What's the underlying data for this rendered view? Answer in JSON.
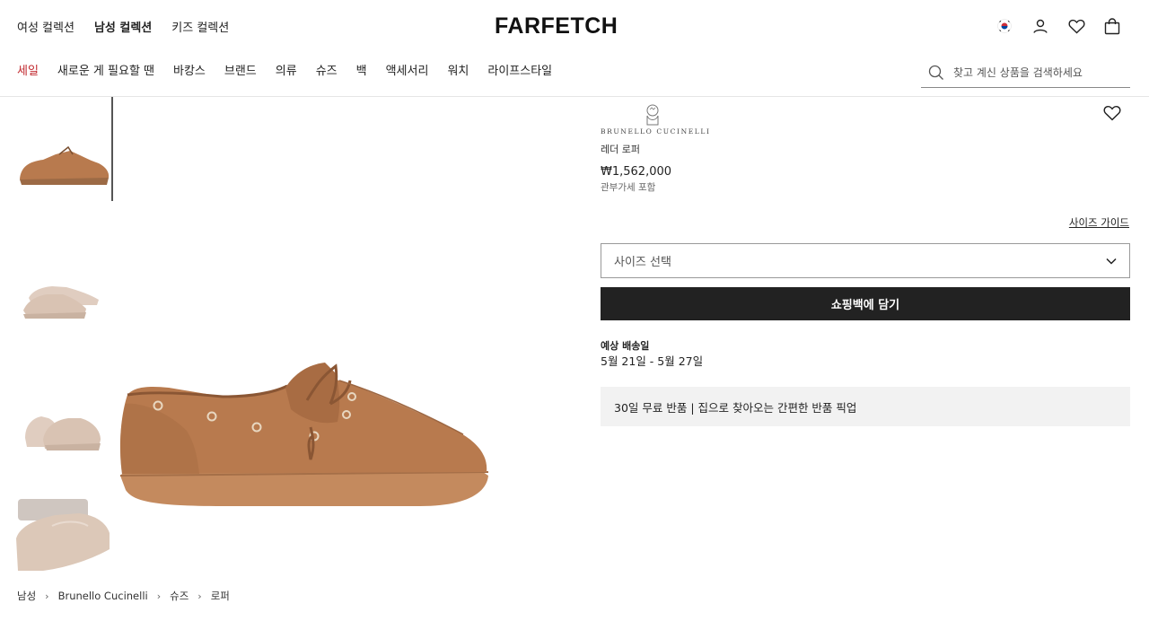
{
  "collections": {
    "women": "여성 컬렉션",
    "men": "남성 컬렉션",
    "kids": "키즈 컬렉션"
  },
  "logo": "FARFETCH",
  "nav": [
    "세일",
    "새로운 게 필요할 땐",
    "바캉스",
    "브랜드",
    "의류",
    "슈즈",
    "백",
    "액세서리",
    "워치",
    "라이프스타일"
  ],
  "search": {
    "placeholder": "찾고 계신 상품을 검색하세요"
  },
  "header_icons": [
    "korea-flag-icon",
    "account-icon",
    "heart-icon",
    "bag-icon"
  ],
  "product": {
    "brand": "BRUNELLO CUCINELLI",
    "name": "레더 로퍼",
    "price": "₩1,562,000",
    "duty_note": "관부가세 포함",
    "size_guide": "사이즈 가이드",
    "size_select": "사이즈 선택",
    "add_to_bag": "쇼핑백에 담기",
    "delivery_label": "예상 배송일",
    "delivery_dates": "5월 21일 - 5월 27일",
    "returns": "30일 무료 반품 | 집으로 찾아오는 간편한 반품 픽업"
  },
  "breadcrumb": [
    "남성",
    "Brunello Cucinelli",
    "슈즈",
    "로퍼"
  ],
  "colors": {
    "sale": "#c1272d",
    "button_bg": "#222222",
    "returns_bg": "#f2f2f2",
    "shoe_brown": "#b87a4e",
    "shoe_beige": "#d9c3b3"
  }
}
